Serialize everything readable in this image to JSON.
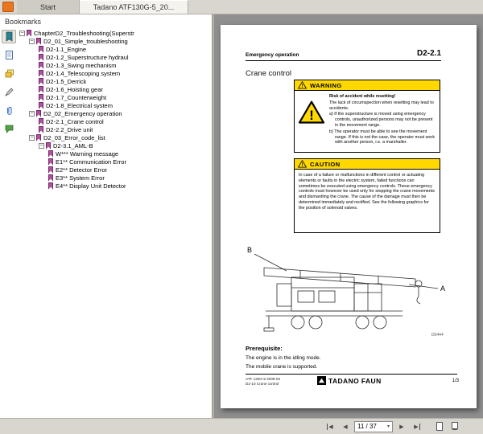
{
  "tabs": {
    "start": "Start",
    "document": "Tadano ATF130G-5_20..."
  },
  "sidebar": {
    "title": "Bookmarks",
    "expander_glyph": "−",
    "panel_icons": [
      "bookmarks",
      "pages",
      "layers",
      "signature",
      "attachments",
      "comments"
    ],
    "bookmarks": [
      {
        "label": "ChapterD2_Troubleshooting(Superstr",
        "depth": 0,
        "expandable": true
      },
      {
        "label": "D2_01_Simple_troubleshooting",
        "depth": 1,
        "expandable": true
      },
      {
        "label": "D2-1.1_Engine",
        "depth": 2,
        "expandable": false
      },
      {
        "label": "D2-1.2_Superstructure hydraul",
        "depth": 2,
        "expandable": false
      },
      {
        "label": "D2-1.3_Swing mechanism",
        "depth": 2,
        "expandable": false
      },
      {
        "label": "D2-1.4_Telescoping system",
        "depth": 2,
        "expandable": false
      },
      {
        "label": "D2-1.5_Derrick",
        "depth": 2,
        "expandable": false
      },
      {
        "label": "D2-1.6_Hoisting gear",
        "depth": 2,
        "expandable": false
      },
      {
        "label": "D2-1.7_Counterweight",
        "depth": 2,
        "expandable": false
      },
      {
        "label": "D2-1.8_Electrical system",
        "depth": 2,
        "expandable": false
      },
      {
        "label": "D2_02_Emergency operation",
        "depth": 1,
        "expandable": true
      },
      {
        "label": "D2-2.1_Crane control",
        "depth": 2,
        "expandable": false
      },
      {
        "label": "D2-2.2_Drive unit",
        "depth": 2,
        "expandable": false
      },
      {
        "label": "D2_03_Error_code_list",
        "depth": 1,
        "expandable": true
      },
      {
        "label": "D2-3.1_AML-B",
        "depth": 2,
        "expandable": true
      },
      {
        "label": "W*** Warning message",
        "depth": 3,
        "expandable": false
      },
      {
        "label": "E1** Communication Error",
        "depth": 3,
        "expandable": false
      },
      {
        "label": "E2** Detector Error",
        "depth": 3,
        "expandable": false
      },
      {
        "label": "E3** System Error",
        "depth": 3,
        "expandable": false
      },
      {
        "label": "E4** Display Unit Detector",
        "depth": 3,
        "expandable": false
      }
    ]
  },
  "page": {
    "header_left": "Emergency operation",
    "header_right": "D2-2.1",
    "title": "Crane control",
    "warning": {
      "label": "WARNING",
      "title": "Risk of accident while resetting!",
      "intro": "The lack of circumspection when resetting may lead to accidents.",
      "item_a": "a) If the superstructure is moved using emergency controls, unauthorized persons may not be present in the movement range.",
      "item_b": "b) The operator must be able to see the movement range. If this is not the case, the operator must work with another person, i.e. a marshaller."
    },
    "caution": {
      "label": "CAUTION",
      "text": "In case of a failure or malfunctions in different control or actuating elements or faults in the electric system, failed functions can sometimes be executed using emergency controls. These emergency controls must however be used only for stopping the crane movements and dismantling the crane. The cause of the damage must then be determined immediately and rectified. See the following graphics for the position of solenoid valves."
    },
    "figure": {
      "label_b": "B",
      "label_a": "A",
      "code": "D0444"
    },
    "prerequisite_title": "Prerequisite:",
    "prerequisites": [
      "The engine is in the idling mode.",
      "The mobile crane is supported."
    ],
    "footer": {
      "line1": "ATF 130G-5 2009-02",
      "line2": "D2-10 Crane control",
      "brand": "TADANO FAUN",
      "page_num": "1/3"
    }
  },
  "statusbar": {
    "page_field": "11 / 37",
    "nav_first": "◀",
    "nav_prev": "◀",
    "nav_next": "▶",
    "nav_last": "▶",
    "dropdown_caret": "▾"
  },
  "colors": {
    "accent_yellow": "#ffd800",
    "bookmark_icon": "#b3509f",
    "canvas_gray": "#8f8f8f"
  }
}
